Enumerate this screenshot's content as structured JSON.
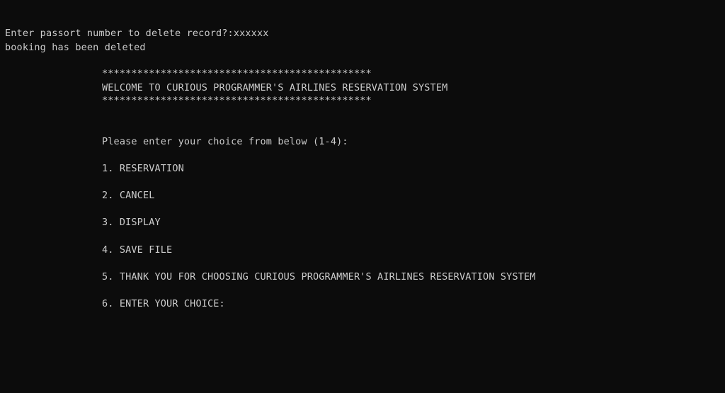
{
  "console": {
    "prompt_line": "Enter passort number to delete record?:xxxxxx",
    "status_line": "booking has been deleted",
    "banner": {
      "border_top": "**********************************************",
      "title": "WELCOME TO CURIOUS PROGRAMMER'S AIRLINES RESERVATION SYSTEM",
      "border_bottom": "**********************************************"
    },
    "menu_prompt": "Please enter your choice from below (1-4):",
    "menu_items": [
      "1. RESERVATION",
      "2. CANCEL",
      "3. DISPLAY",
      "4. SAVE FILE",
      "5. THANK YOU FOR CHOOSING CURIOUS PROGRAMMER'S AIRLINES RESERVATION SYSTEM",
      "6. ENTER YOUR CHOICE:"
    ]
  }
}
